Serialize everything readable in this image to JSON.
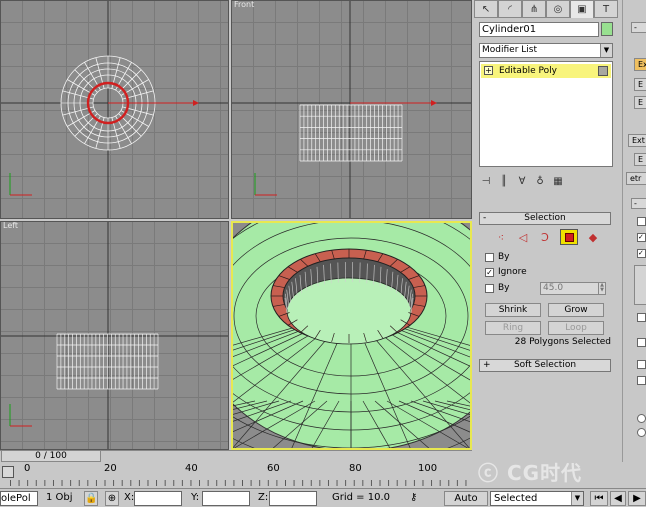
{
  "viewports": {
    "top": {
      "label": ""
    },
    "front": {
      "label": "Front"
    },
    "left": {
      "label": "Left"
    },
    "perspective": {
      "label": ""
    }
  },
  "command_panel": {
    "tab_icons": [
      "pointer-icon",
      "shapes-icon",
      "hierarchy-icon",
      "motion-icon",
      "display-icon",
      "utilities-icon"
    ],
    "object_name": "Cylinder01",
    "object_color": "#98e090",
    "modifier_list_label": "Modifier List",
    "stack_item": "Editable Poly",
    "selection_rollout": {
      "title": "Selection",
      "by_vertex_label": "By",
      "ignore_backfacing_label": "Ignore",
      "by_angle_label": "By",
      "angle_value": "45.0",
      "shrink_label": "Shrink",
      "grow_label": "Grow",
      "ring_label": "Ring",
      "loop_label": "Loop",
      "status": "28 Polygons Selected"
    },
    "soft_selection_title": "Soft Selection"
  },
  "timeline": {
    "slider_label": "0 / 100",
    "ticks": [
      "0",
      "20",
      "40",
      "60",
      "80",
      "100"
    ]
  },
  "status_bar": {
    "cmd_label": "olePol",
    "selection_count": "1 Obj",
    "x_label": "X:",
    "y_label": "Y:",
    "z_label": "Z:",
    "grid": "Grid = 10.0",
    "auto_key": "Auto Key",
    "selected_option": "Selected"
  },
  "far_right": {
    "items": [
      "Ex",
      "E",
      "E",
      "Ext",
      "E",
      "etr"
    ]
  },
  "watermark": "CG时代"
}
